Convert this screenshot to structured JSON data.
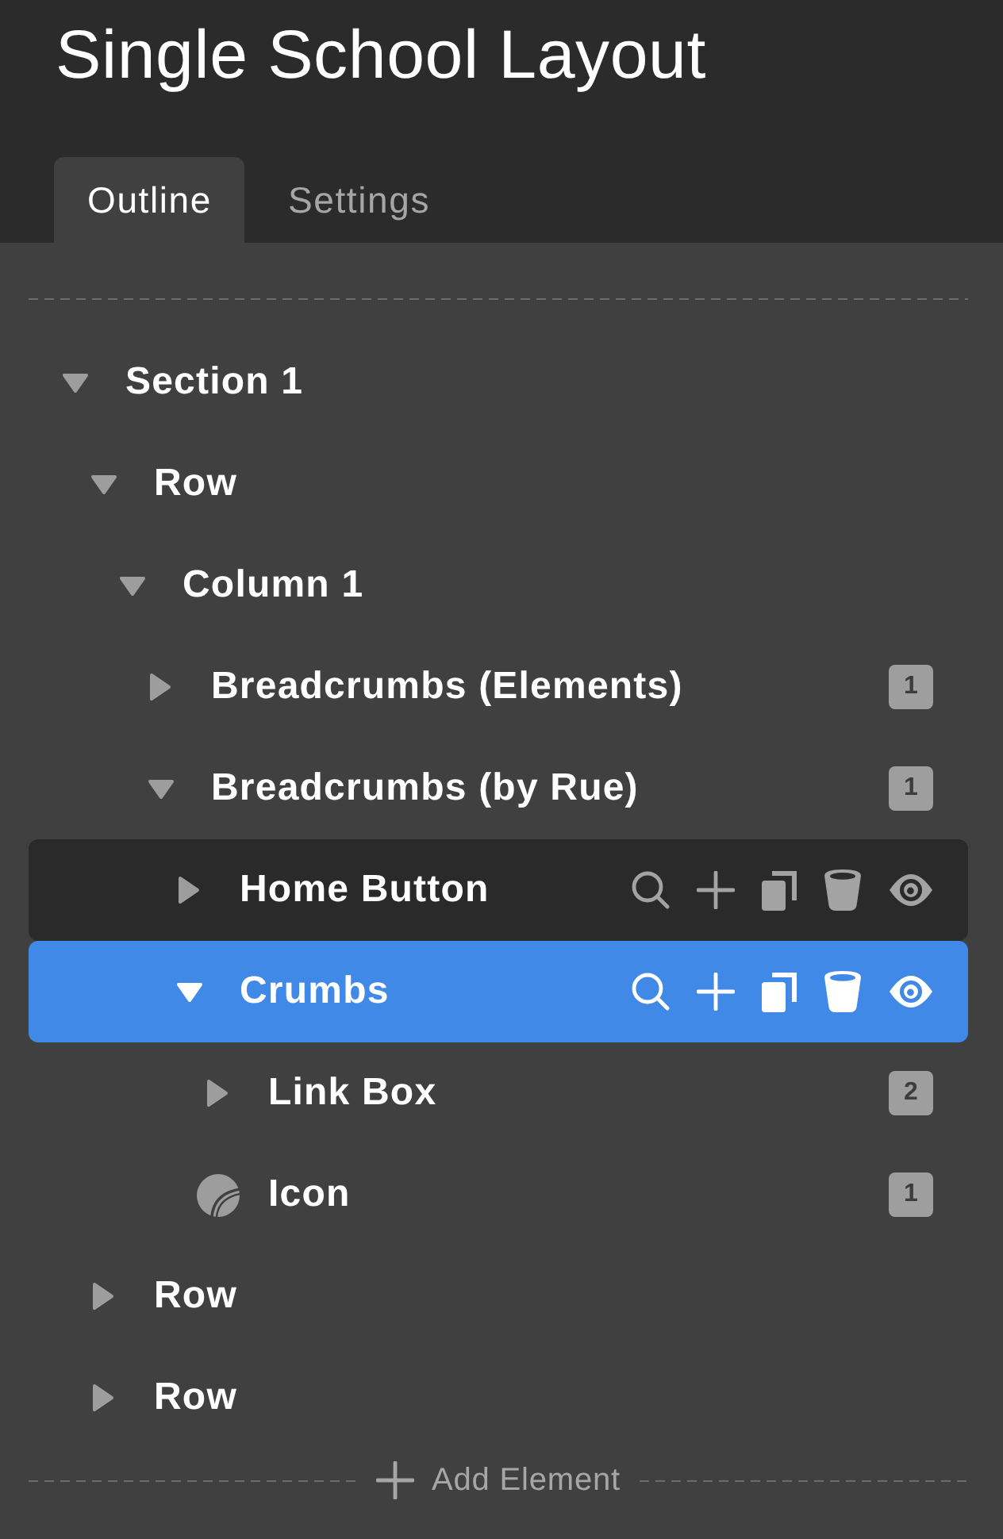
{
  "header": {
    "title": "Single School Layout"
  },
  "tabs": [
    {
      "label": "Outline",
      "selected": true
    },
    {
      "label": "Settings",
      "selected": false
    }
  ],
  "outline": {
    "items": [
      {
        "kind": "node",
        "label": "Section 1",
        "expanded": true,
        "selected": false,
        "hovered": false,
        "children": [
          {
            "kind": "node",
            "label": "Row",
            "expanded": true,
            "selected": false,
            "hovered": false,
            "children": [
              {
                "kind": "node",
                "label": "Column 1",
                "expanded": true,
                "selected": false,
                "hovered": false,
                "children": [
                  {
                    "kind": "node",
                    "label": "Breadcrumbs (Elements)",
                    "expanded": false,
                    "selected": false,
                    "hovered": false,
                    "badge": "1"
                  },
                  {
                    "kind": "node",
                    "label": "Breadcrumbs (by Rue)",
                    "expanded": true,
                    "selected": false,
                    "hovered": false,
                    "badge": "1",
                    "children": [
                      {
                        "kind": "node",
                        "label": "Home Button",
                        "expanded": false,
                        "selected": false,
                        "hovered": true
                      },
                      {
                        "kind": "node",
                        "label": "Crumbs",
                        "expanded": true,
                        "selected": true,
                        "hovered": false,
                        "children": [
                          {
                            "kind": "node",
                            "label": "Link Box",
                            "expanded": false,
                            "selected": false,
                            "hovered": false,
                            "badge": "2"
                          },
                          {
                            "kind": "icon",
                            "label": "Icon",
                            "selected": false,
                            "hovered": false,
                            "badge": "1"
                          }
                        ]
                      }
                    ]
                  }
                ]
              }
            ]
          },
          {
            "kind": "node",
            "label": "Row",
            "expanded": false,
            "selected": false,
            "hovered": false
          },
          {
            "kind": "node",
            "label": "Row",
            "expanded": false,
            "selected": false,
            "hovered": false
          }
        ]
      }
    ]
  },
  "add_element": {
    "label": "Add Element"
  }
}
